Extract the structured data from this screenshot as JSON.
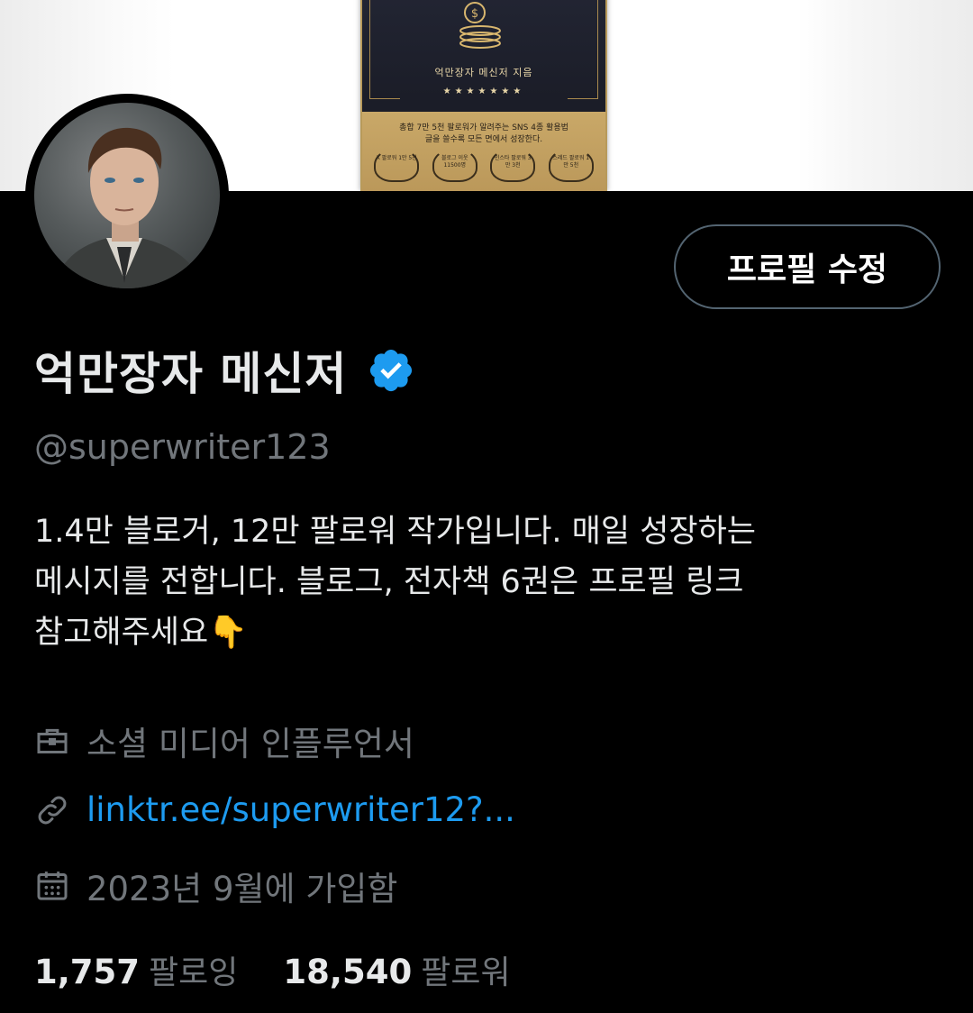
{
  "banner": {
    "book_author": "억만장자 메신저 지음",
    "book_stars": "★★★★★★★",
    "book_blurb_1": "총합 7만 5천 팔로워가 알려주는 SNS 4종 활용법",
    "book_blurb_2": "글을 쓸수록 모든 면에서 성장한다.",
    "badges": [
      "X 팔로워 1만 5천",
      "블로그 이웃 11500명",
      "인스타 팔로워 3만 3천",
      "스레드 팔로워 1만 5천"
    ]
  },
  "profile": {
    "edit_button_label": "프로필 수정",
    "display_name": "억만장자 메신저",
    "handle": "@superwriter123",
    "bio": "1.4만 블로거, 12만 팔로워 작가입니다. 매일 성장하는\n메시지를 전합니다.  블로그, 전자책 6권은 프로필 링크\n참고해주세요👇",
    "job": "소셜 미디어 인플루언서",
    "link": "linktr.ee/superwriter12?...",
    "joined": "2023년 9월에 가입함",
    "following_count": "1,757",
    "following_label": "팔로잉",
    "followers_count": "18,540",
    "followers_label": "팔로워"
  },
  "colors": {
    "background": "#000000",
    "text_primary": "#e7e9ea",
    "text_secondary": "#71767b",
    "link": "#1d9bf0",
    "verified": "#1d9bf0",
    "button_border": "#536471"
  },
  "icons": {
    "job": "briefcase-icon",
    "link": "link-icon",
    "joined": "calendar-icon",
    "verified": "verified-badge-icon"
  }
}
